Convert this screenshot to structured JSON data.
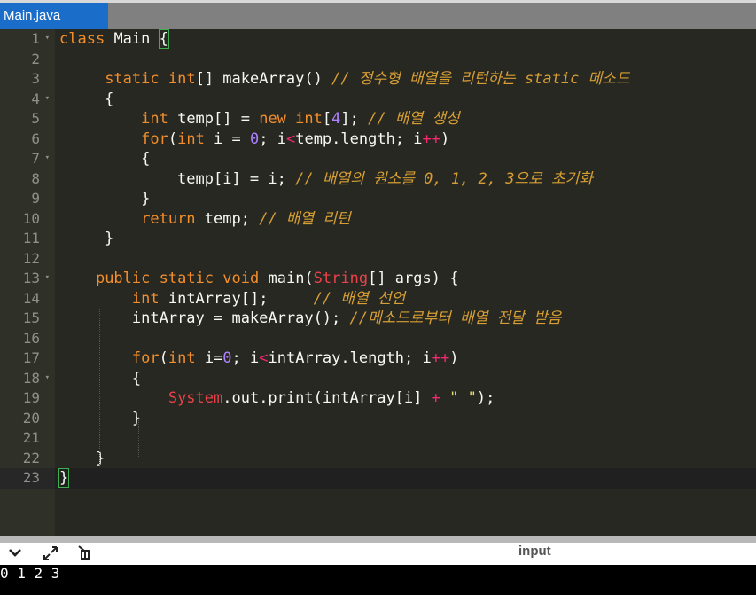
{
  "tab": {
    "label": "Main.java"
  },
  "editor": {
    "lines": [
      {
        "n": "1",
        "fold": true,
        "html": "<span class=\"kw2\">class</span> <span class=\"fn\">Main</span> <span class=\"brace-match\">{</span>"
      },
      {
        "n": "2",
        "fold": false,
        "html": ""
      },
      {
        "n": "3",
        "fold": false,
        "html": "     <span class=\"kw2\">static</span> <span class=\"ty\">int</span>[] makeArray() <span class=\"cm\">// 정수형 배열을 리턴하는 static 메소드</span>"
      },
      {
        "n": "4",
        "fold": true,
        "html": "     {"
      },
      {
        "n": "5",
        "fold": false,
        "html": "         <span class=\"ty\">int</span> temp[] = <span class=\"kw2\">new</span> <span class=\"ty\">int</span>[<span class=\"nm\">4</span>]; <span class=\"cm\">// 배열 생성</span>"
      },
      {
        "n": "6",
        "fold": false,
        "html": "         <span class=\"kw2\">for</span>(<span class=\"ty\">int</span> i = <span class=\"nm\">0</span>; i<span class=\"kw\">&lt;</span>temp.length; i<span class=\"kw\">++</span>)"
      },
      {
        "n": "7",
        "fold": true,
        "html": "         {"
      },
      {
        "n": "8",
        "fold": false,
        "html": "             temp[i] = i; <span class=\"cm\">// 배열의 원소를 0, 1, 2, 3으로 초기화</span>"
      },
      {
        "n": "9",
        "fold": false,
        "html": "         }"
      },
      {
        "n": "10",
        "fold": false,
        "html": "         <span class=\"kw2\">return</span> temp; <span class=\"cm\">// 배열 리턴</span>"
      },
      {
        "n": "11",
        "fold": false,
        "html": "     }"
      },
      {
        "n": "12",
        "fold": false,
        "html": ""
      },
      {
        "n": "13",
        "fold": true,
        "html": "    <span class=\"kw2\">public</span> <span class=\"kw2\">static</span> <span class=\"ty\">void</span> main(<span class=\"cls\">String</span>[] args) {"
      },
      {
        "n": "14",
        "fold": false,
        "html": "        <span class=\"ty\">int</span> intArray[];     <span class=\"cm\">// 배열 선언</span>"
      },
      {
        "n": "15",
        "fold": false,
        "html": "        intArray = makeArray(); <span class=\"cm\">//메소드로부터 배열 전달 받음</span>"
      },
      {
        "n": "16",
        "fold": false,
        "html": ""
      },
      {
        "n": "17",
        "fold": false,
        "html": "        <span class=\"kw2\">for</span>(<span class=\"ty\">int</span> i=<span class=\"nm\">0</span>; i<span class=\"kw\">&lt;</span>intArray.length; i<span class=\"kw\">++</span>)"
      },
      {
        "n": "18",
        "fold": true,
        "html": "        {"
      },
      {
        "n": "19",
        "fold": false,
        "html": "            <span class=\"cls\">System</span>.out.print(intArray[i] <span class=\"kw\">+</span> <span class=\"str\">\" \"</span>);"
      },
      {
        "n": "20",
        "fold": false,
        "html": "        }"
      },
      {
        "n": "21",
        "fold": false,
        "html": ""
      },
      {
        "n": "22",
        "fold": false,
        "html": "    }"
      },
      {
        "n": "23",
        "fold": false,
        "html": "<span class=\"brace-match\">}</span>"
      }
    ]
  },
  "toolbar": {
    "collapse_icon": "chevron-down-icon",
    "expand_icon": "expand-arrows-icon",
    "clear_icon": "clear-console-icon",
    "input_label": "input"
  },
  "console": {
    "output": "0 1 2 3"
  }
}
